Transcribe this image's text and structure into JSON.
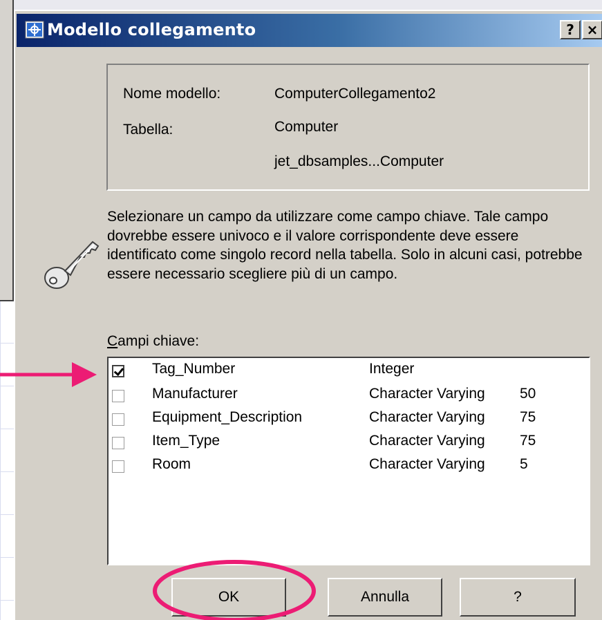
{
  "dialog": {
    "title": "Modello collegamento",
    "help_button": "?",
    "close_button": "×"
  },
  "info": {
    "model_name_label": "Nome modello:",
    "model_name_value": "ComputerCollegamento2",
    "table_label": "Tabella:",
    "table_value": "Computer",
    "source_value": "jet_dbsamples...Computer"
  },
  "description": "Selezionare un campo da utilizzare come campo chiave. Tale campo dovrebbe essere univoco e il valore corrispondente deve essere identificato come singolo record nella tabella. Solo in alcuni casi, potrebbe essere necessario scegliere più di un campo.",
  "key_fields": {
    "label_accel": "C",
    "label_rest": "ampi chiave:",
    "rows": [
      {
        "checked": true,
        "name": "Tag_Number",
        "type": "Integer",
        "length": ""
      },
      {
        "checked": false,
        "name": "Manufacturer",
        "type": "Character Varying",
        "length": "50"
      },
      {
        "checked": false,
        "name": "Equipment_Description",
        "type": "Character Varying",
        "length": "75"
      },
      {
        "checked": false,
        "name": "Item_Type",
        "type": "Character Varying",
        "length": "75"
      },
      {
        "checked": false,
        "name": "Room",
        "type": "Character Varying",
        "length": "5"
      }
    ]
  },
  "buttons": {
    "ok": "OK",
    "cancel": "Annulla",
    "help": "?"
  },
  "colors": {
    "annotation": "#ec1c74",
    "title_bar": "#0a246a",
    "dialog_face": "#d4d0c8"
  },
  "icons": {
    "title": "link-model-icon",
    "key": "key-icon",
    "annotation_arrow": "arrow-right-icon",
    "annotation_circle": "highlight-ellipse"
  }
}
